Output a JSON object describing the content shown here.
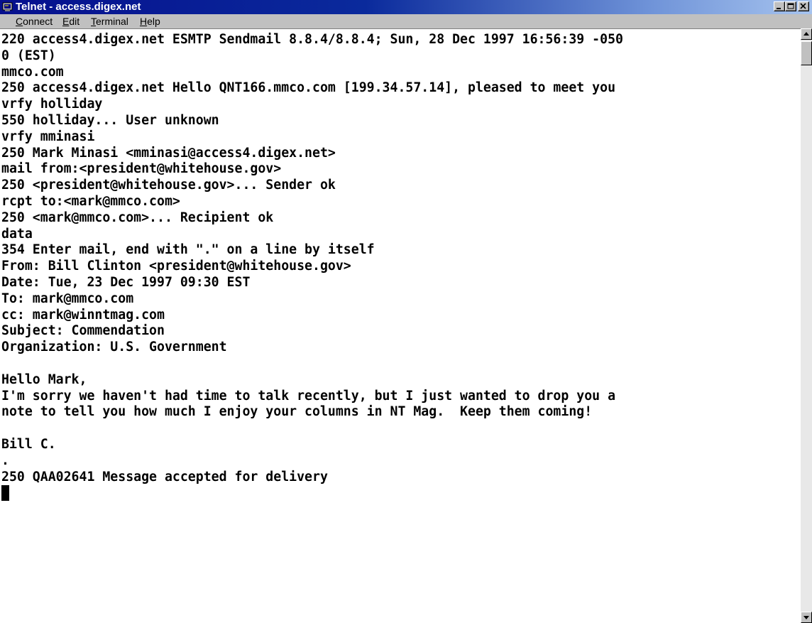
{
  "window": {
    "title": "Telnet - access.digex.net",
    "icon": "terminal-app-icon",
    "controls": [
      "minimize-icon",
      "maximize-icon",
      "close-icon"
    ],
    "title_gradient": [
      "#06108e",
      "#a6c3ee"
    ]
  },
  "menu": {
    "items": [
      {
        "label": "Connect",
        "mnemonic": "C"
      },
      {
        "label": "Edit",
        "mnemonic": "E"
      },
      {
        "label": "Terminal",
        "mnemonic": "T"
      },
      {
        "label": "Help",
        "mnemonic": "H"
      }
    ]
  },
  "terminal": {
    "lines": [
      "220 access4.digex.net ESMTP Sendmail 8.8.4/8.8.4; Sun, 28 Dec 1997 16:56:39 -050",
      "0 (EST)",
      "mmco.com",
      "250 access4.digex.net Hello QNT166.mmco.com [199.34.57.14], pleased to meet you",
      "vrfy holliday",
      "550 holliday... User unknown",
      "vrfy mminasi",
      "250 Mark Minasi <mminasi@access4.digex.net>",
      "mail from:<president@whitehouse.gov>",
      "250 <president@whitehouse.gov>... Sender ok",
      "rcpt to:<mark@mmco.com>",
      "250 <mark@mmco.com>... Recipient ok",
      "data",
      "354 Enter mail, end with \".\" on a line by itself",
      "From: Bill Clinton <president@whitehouse.gov>",
      "Date: Tue, 23 Dec 1997 09:30 EST",
      "To: mark@mmco.com",
      "cc: mark@winntmag.com",
      "Subject: Commendation",
      "Organization: U.S. Government",
      "",
      "Hello Mark,",
      "I'm sorry we haven't had time to talk recently, but I just wanted to drop you a",
      "note to tell you how much I enjoy your columns in NT Mag.  Keep them coming!",
      "",
      "Bill C.",
      ".",
      "250 QAA02641 Message accepted for delivery"
    ]
  }
}
